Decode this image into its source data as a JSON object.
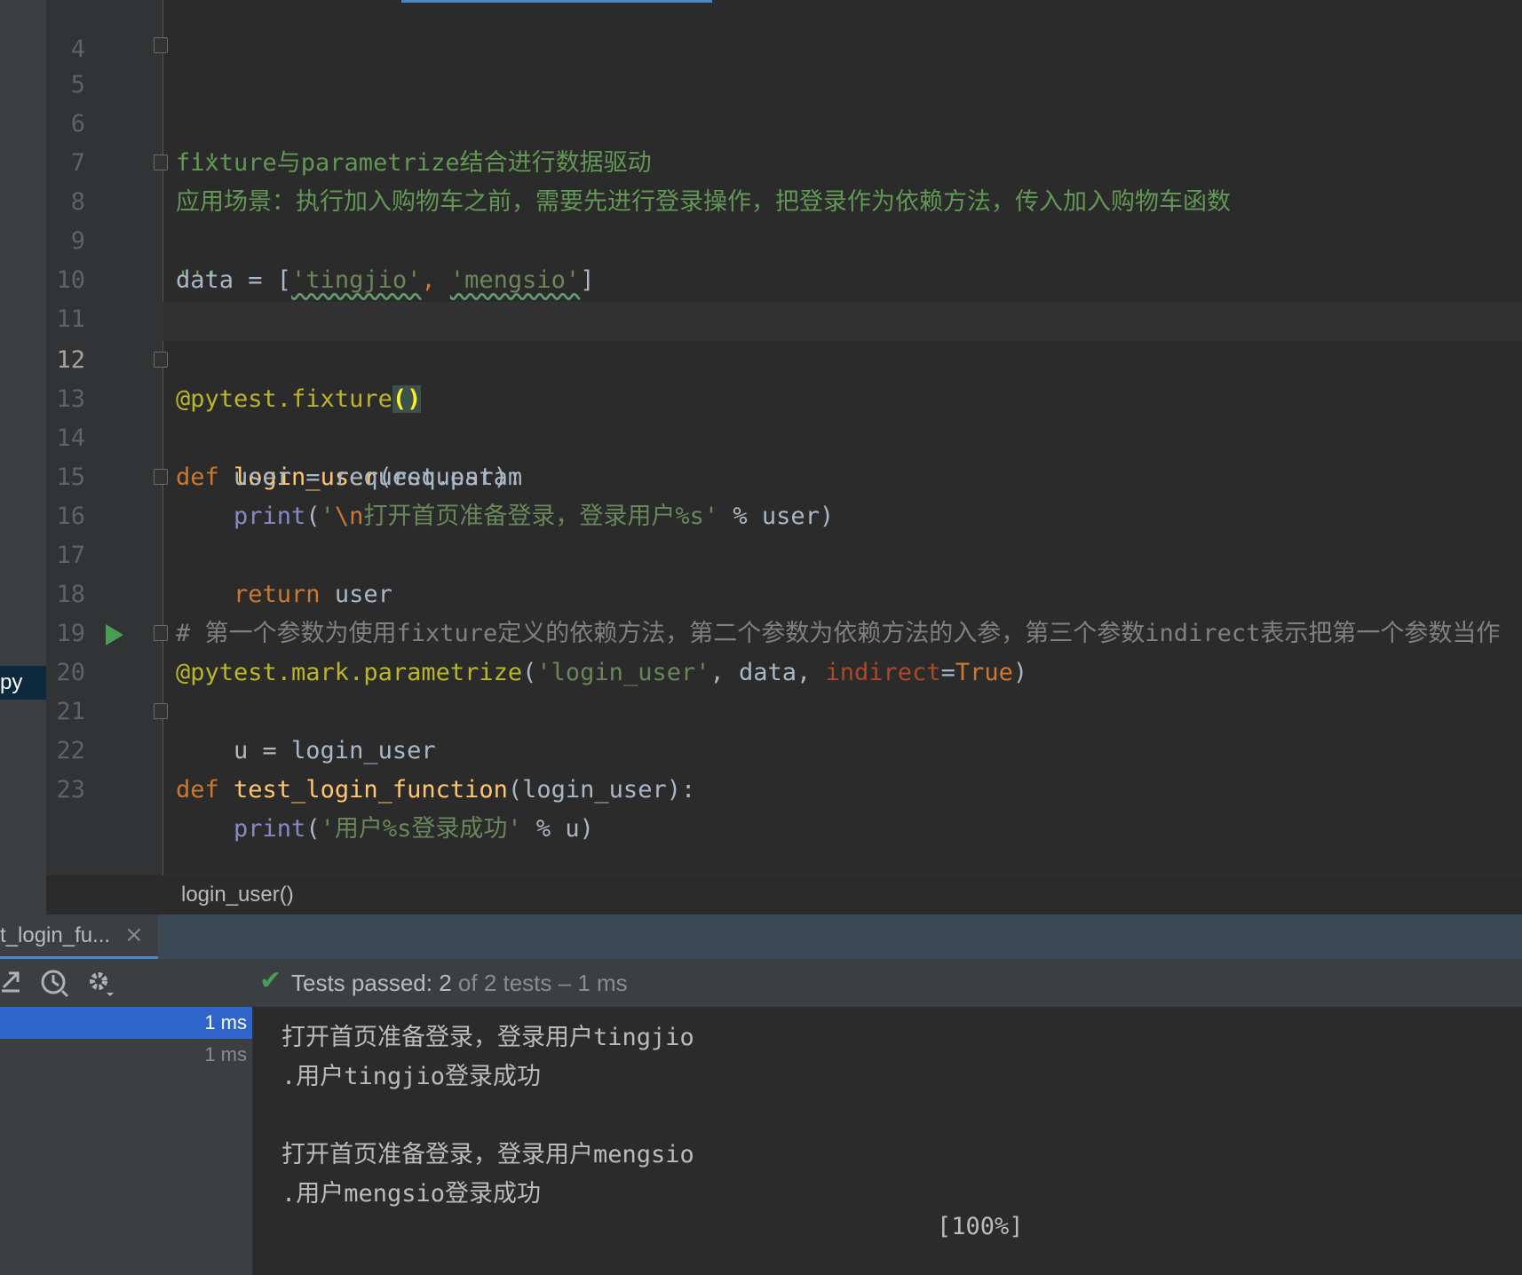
{
  "sidebar": {
    "file_tab_label": "py"
  },
  "editor": {
    "lines": [
      {
        "num": "4"
      },
      {
        "num": "5"
      },
      {
        "num": "6"
      },
      {
        "num": "7"
      },
      {
        "num": "8"
      },
      {
        "num": "9"
      },
      {
        "num": "10"
      },
      {
        "num": "11"
      },
      {
        "num": "12"
      },
      {
        "num": "13"
      },
      {
        "num": "14"
      },
      {
        "num": "15"
      },
      {
        "num": "16"
      },
      {
        "num": "17"
      },
      {
        "num": "18"
      },
      {
        "num": "19"
      },
      {
        "num": "20"
      },
      {
        "num": "21"
      },
      {
        "num": "22"
      },
      {
        "num": "23"
      }
    ],
    "code": {
      "doc_open": "'''",
      "doc_line1": "fixture与parametrize结合进行数据驱动",
      "doc_line2": "应用场景：执行加入购物车之前，需要先进行登录操作，把登录作为依赖方法，传入加入购物车函数",
      "doc_close": "'''",
      "data_var": "data = [",
      "data_s1": "'tingjio'",
      "data_comma": ", ",
      "data_s2": "'mengsio'",
      "data_end": "]",
      "deco1": "@pytest.fixture",
      "deco1_paren": "()",
      "def_kw": "def ",
      "fn1": "login_user",
      "fn1_args": "(request):",
      "l14": "    user = request.param",
      "l15_indent": "    ",
      "print_kw": "print",
      "l15_open": "(",
      "l15_s_a": "'",
      "l15_esc": "\\n",
      "l15_s_b": "打开首页准备登录，登录用户%s'",
      "l15_rest": " % user)",
      "l16_indent": "    ",
      "return_kw": "return",
      "l16_rest": " user",
      "comment": "# 第一个参数为使用fixture定义的依赖方法，第二个参数为依赖方法的入参，第三个参数indirect表示把第一个参数当作",
      "deco2": "@pytest.mark.parametrize",
      "deco2_open": "(",
      "deco2_s": "'login_user'",
      "deco2_mid": ", data, ",
      "deco2_param": "indirect",
      "deco2_eq": "=",
      "deco2_true": "True",
      "deco2_close": ")",
      "fn2": "test_login_function",
      "fn2_args": "(login_user):",
      "l21": "    u = login_user",
      "l22_indent": "    ",
      "l22_open": "(",
      "l22_s": "'用户%s登录成功'",
      "l22_rest": " % u)"
    },
    "breadcrumb": "login_user()"
  },
  "run": {
    "tab_label": "t_login_fu...",
    "tab_close": "×",
    "status_prefix": "Tests passed: ",
    "status_count": "2",
    "status_of": " of ",
    "status_total": "2 tests",
    "status_time": " – 1 ms",
    "tree": [
      {
        "time": "1 ms",
        "selected": true
      },
      {
        "time": "1 ms",
        "selected": false
      }
    ],
    "output": [
      "打开首页准备登录，登录用户tingjio",
      ".用户tingjio登录成功",
      "",
      "打开首页准备登录，登录用户mengsio",
      ".用户mengsio登录成功",
      "[100%]"
    ]
  },
  "icons": {
    "export": "export-icon",
    "history": "history-icon",
    "settings": "gear-icon",
    "pass": "check-icon",
    "run": "run-icon"
  }
}
